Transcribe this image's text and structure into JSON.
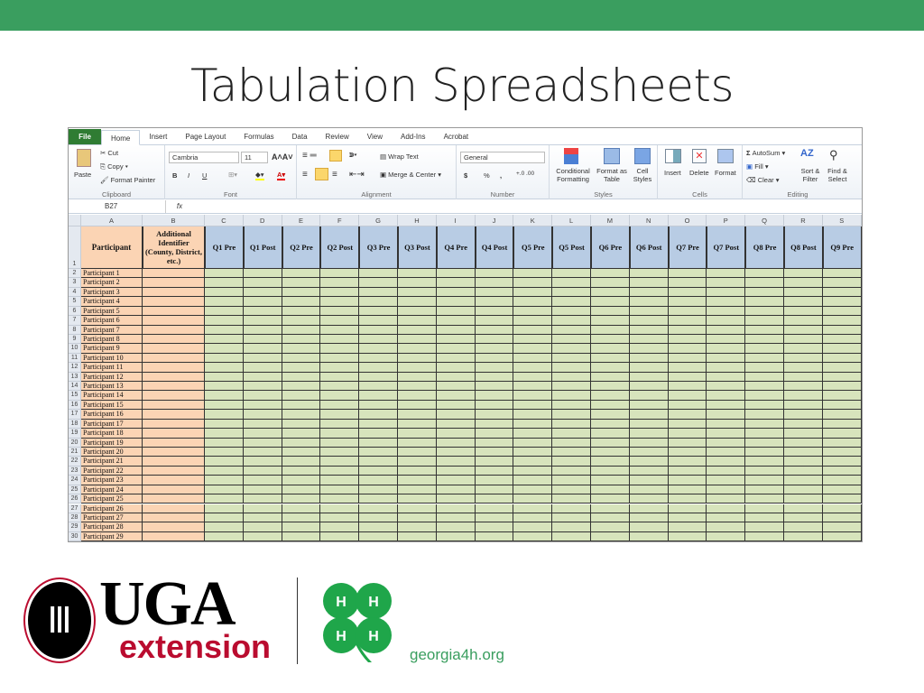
{
  "slide": {
    "title": "Tabulation Spreadsheets",
    "accent": "#3a9e5f"
  },
  "excel": {
    "tabs": [
      "File",
      "Home",
      "Insert",
      "Page Layout",
      "Formulas",
      "Data",
      "Review",
      "View",
      "Add-Ins",
      "Acrobat"
    ],
    "active_tab": "Home",
    "clipboard": {
      "paste": "Paste",
      "cut": "Cut",
      "copy": "Copy",
      "format_painter": "Format Painter",
      "label": "Clipboard"
    },
    "font": {
      "name": "Cambria",
      "size": "11",
      "bold": "B",
      "italic": "I",
      "underline": "U",
      "label": "Font"
    },
    "alignment": {
      "wrap": "Wrap Text",
      "merge": "Merge & Center",
      "label": "Alignment"
    },
    "number": {
      "format": "General",
      "currency": "$",
      "percent": "%",
      "comma": ",",
      "label": "Number"
    },
    "styles": {
      "conditional": "Conditional Formatting",
      "table": "Format as Table",
      "cell": "Cell Styles",
      "label": "Styles"
    },
    "cells": {
      "insert": "Insert",
      "delete": "Delete",
      "format": "Format",
      "label": "Cells"
    },
    "editing": {
      "autosum": "AutoSum",
      "fill": "Fill",
      "clear": "Clear",
      "sort": "Sort & Filter",
      "find": "Find & Select",
      "label": "Editing"
    },
    "name_box": "B27",
    "fx": "fx",
    "columns": [
      "A",
      "B",
      "C",
      "D",
      "E",
      "F",
      "G",
      "H",
      "I",
      "J",
      "K",
      "L",
      "M",
      "N",
      "O",
      "P",
      "Q",
      "R",
      "S"
    ],
    "headers": [
      "Participant",
      "Additional Identifier (County, District, etc.)",
      "Q1 Pre",
      "Q1 Post",
      "Q2 Pre",
      "Q2 Post",
      "Q3 Pre",
      "Q3 Post",
      "Q4 Pre",
      "Q4 Post",
      "Q5 Pre",
      "Q5 Post",
      "Q6 Pre",
      "Q6 Post",
      "Q7 Pre",
      "Q7 Post",
      "Q8 Pre",
      "Q8 Post",
      "Q9 Pre"
    ],
    "participants": [
      "Participant 1",
      "Participant 2",
      "Participant 3",
      "Participant 4",
      "Participant 5",
      "Participant 6",
      "Participant 7",
      "Participant 8",
      "Participant 9",
      "Participant 10",
      "Participant 11",
      "Participant 12",
      "Participant 13",
      "Participant 14",
      "Participant 15",
      "Participant 16",
      "Participant 17",
      "Participant 18",
      "Participant 19",
      "Participant 20",
      "Participant 21",
      "Participant 22",
      "Participant 23",
      "Participant 24",
      "Participant 25",
      "Participant 26",
      "Participant 27",
      "Participant 28",
      "Participant 29"
    ],
    "colors": {
      "id_fill": "#fbd4b4",
      "question_header": "#b8cce4",
      "data_fill": "#d7e4bc"
    }
  },
  "logos": {
    "uga": "UGA",
    "extension": "extension",
    "site": "georgia4h.org",
    "clover_letter": "H"
  }
}
